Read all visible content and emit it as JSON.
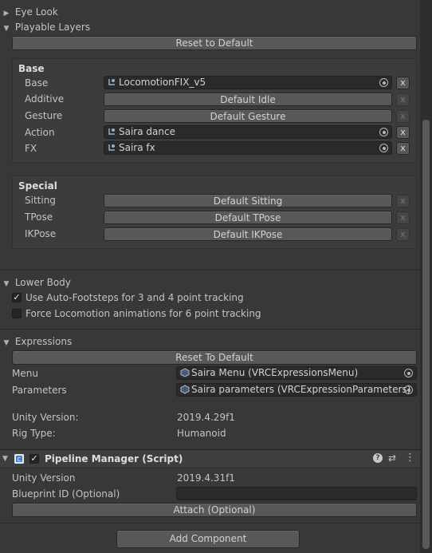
{
  "eye_look": {
    "label": "Eye Look"
  },
  "playable_layers": {
    "label": "Playable Layers",
    "reset_button": "Reset to Default",
    "base": {
      "title": "Base",
      "rows": [
        {
          "label": "Base",
          "value": "LocomotionFIX_v5"
        },
        {
          "label": "Additive",
          "value": "Default Idle"
        },
        {
          "label": "Gesture",
          "value": "Default Gesture"
        },
        {
          "label": "Action",
          "value": "Saira dance"
        },
        {
          "label": "FX",
          "value": "Saira fx"
        }
      ]
    },
    "special": {
      "title": "Special",
      "rows": [
        {
          "label": "Sitting",
          "value": "Default Sitting"
        },
        {
          "label": "TPose",
          "value": "Default TPose"
        },
        {
          "label": "IKPose",
          "value": "Default IKPose"
        }
      ]
    },
    "remove_glyph": "x"
  },
  "lower_body": {
    "label": "Lower Body",
    "auto_footsteps": {
      "label": "Use Auto-Footsteps for 3 and 4 point tracking",
      "checked": true
    },
    "force_locomotion": {
      "label": "Force Locomotion animations for 6 point tracking",
      "checked": false
    },
    "check_glyph": "✓"
  },
  "expressions": {
    "label": "Expressions",
    "reset_button": "Reset To Default",
    "menu": {
      "label": "Menu",
      "value": "Saira Menu (VRCExpressionsMenu)"
    },
    "parameters": {
      "label": "Parameters",
      "value": "Saira parameters (VRCExpressionParameters)"
    }
  },
  "info": {
    "unity_version_label": "Unity Version:",
    "unity_version_value": "2019.4.29f1",
    "rig_type_label": "Rig Type:",
    "rig_type_value": "Humanoid"
  },
  "pipeline": {
    "title": "Pipeline Manager (Script)",
    "check_glyph": "✓",
    "unity_version_label": "Unity Version",
    "unity_version_value": "2019.4.31f1",
    "blueprint_label": "Blueprint ID (Optional)",
    "blueprint_value": "",
    "attach_button": "Attach (Optional)",
    "help_glyph": "?",
    "presets_glyph": "⇄",
    "menu_glyph": "⋮"
  },
  "add_component_button": "Add Component",
  "glyphs": {
    "expanded": "▼",
    "collapsed": "▶"
  },
  "colors": {
    "background": "#383838",
    "field": "#2a2a2a",
    "button": "#585858",
    "text": "#c4c4c4"
  }
}
